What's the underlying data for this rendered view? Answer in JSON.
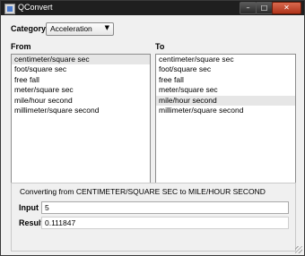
{
  "window": {
    "title": "QConvert"
  },
  "titlebar_buttons": {
    "minimize": "–",
    "maximize": "□",
    "close": "✕"
  },
  "category": {
    "label": "Category",
    "value": "Acceleration",
    "arrow": "▼"
  },
  "from": {
    "label": "From",
    "items": [
      "centimeter/square sec",
      "foot/square sec",
      "free fall",
      "meter/square sec",
      "mile/hour second",
      "millimeter/square second"
    ],
    "selected_index": 0
  },
  "to": {
    "label": "To",
    "items": [
      "centimeter/square sec",
      "foot/square sec",
      "free fall",
      "meter/square sec",
      "mile/hour second",
      "millimeter/square second"
    ],
    "selected_index": 4
  },
  "conversion": {
    "description": "Converting from CENTIMETER/SQUARE SEC to MILE/HOUR SECOND",
    "input_label": "Input",
    "input_value": "5",
    "result_label": "Result",
    "result_value": "0.111847"
  }
}
